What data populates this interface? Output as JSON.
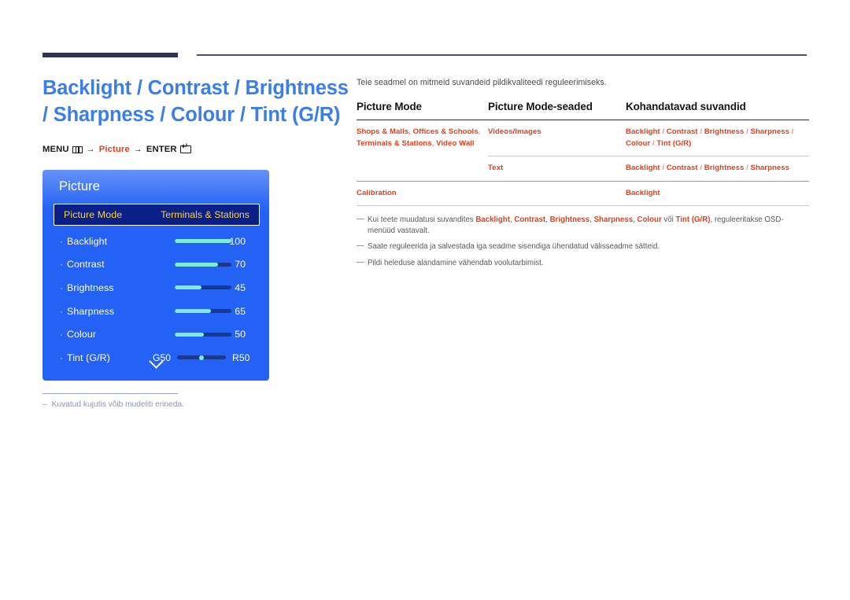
{
  "doc": {
    "title": "Backlight / Contrast / Brightness / Sharpness / Colour / Tint (G/R)"
  },
  "breadcrumb": {
    "menu_label": "MENU",
    "menu_icon": "menu-grid-icon",
    "arrow": "→",
    "picture_label": "Picture",
    "enter_label": "ENTER",
    "enter_icon": "enter-key-icon"
  },
  "osd": {
    "title": "Picture",
    "selected": {
      "label": "Picture Mode",
      "value": "Terminals & Stations"
    },
    "items": [
      {
        "label": "Backlight",
        "value": "100",
        "fill_pct": 100
      },
      {
        "label": "Contrast",
        "value": "70",
        "fill_pct": 76
      },
      {
        "label": "Brightness",
        "value": "45",
        "fill_pct": 47
      },
      {
        "label": "Sharpness",
        "value": "65",
        "fill_pct": 64
      },
      {
        "label": "Colour",
        "value": "50",
        "fill_pct": 52
      }
    ],
    "tint": {
      "label": "Tint (G/R)",
      "left_label": "G50",
      "right_label": "R50",
      "position_pct": 50
    },
    "more_icon": "chevron-down-icon",
    "colors": {
      "panel": "#2362f5",
      "selected_bg": "#0a1f87",
      "selected_text": "#ffd42e",
      "slider_fill": "#7fecd8",
      "slider_track": "#17398f"
    }
  },
  "left_note": {
    "dash": "–",
    "text": "Kuvatud kujutis võib mudeliti erineda."
  },
  "right": {
    "intro": "Teie seadmel on mitmeid suvandeid pildikvaliteedi reguleerimiseks.",
    "table": {
      "headers": [
        "Picture Mode",
        "Picture Mode-seaded",
        "Kohandatavad suvandid"
      ],
      "rows": [
        {
          "c1": "Shops & Malls, Offices & Schools, Terminals & Stations, Video Wall",
          "c2": "Videos/Images",
          "c3": "Backlight / Contrast / Brightness / Sharpness / Colour / Tint (G/R)"
        },
        {
          "c1": "",
          "c2": "Text",
          "c3": "Backlight / Contrast / Brightness / Sharpness"
        },
        {
          "c1": "Calibration",
          "c2": "",
          "c3": "Backlight"
        }
      ]
    },
    "notes": [
      {
        "dash": "—",
        "pre": "Kui teete muudatusi suvandites ",
        "terms": [
          "Backlight",
          "Contrast",
          "Brightness",
          "Sharpness",
          "Colour"
        ],
        "mid": " või ",
        "last_term": "Tint (G/R)",
        "post": ", reguleeritakse OSD-menüüd vastavalt."
      },
      {
        "dash": "—",
        "text": "Saate reguleerida ja salvestada iga seadme sisendiga ühendatud välisseadme sätteid."
      },
      {
        "dash": "—",
        "text": "Pildi heleduse alandamine vähendab voolutarbimist."
      }
    ]
  },
  "colors": {
    "title_blue": "#3b7fe6",
    "accent_orange": "#e0401f",
    "rule_navy": "#2e3356"
  }
}
